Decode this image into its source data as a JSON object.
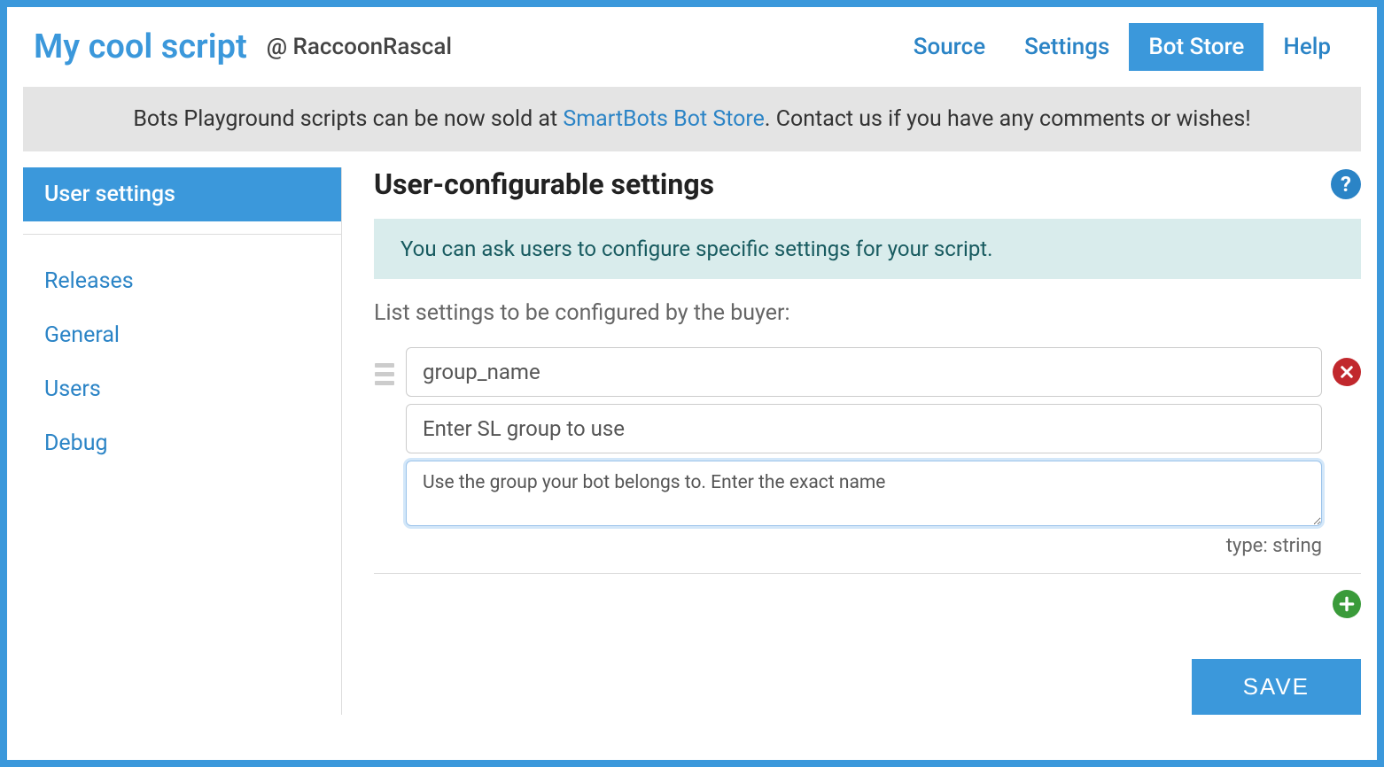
{
  "header": {
    "title": "My cool script",
    "author_prefix": "@ ",
    "author": "RaccoonRascal",
    "tabs": [
      {
        "label": "Source",
        "active": false
      },
      {
        "label": "Settings",
        "active": false
      },
      {
        "label": "Bot Store",
        "active": true
      },
      {
        "label": "Help",
        "active": false
      }
    ]
  },
  "banner": {
    "text_before": "Bots Playground scripts can be now sold at ",
    "link_text": "SmartBots Bot Store",
    "text_after": ". Contact us if you have any comments or wishes!"
  },
  "sidebar": {
    "items": [
      {
        "label": "User settings",
        "active": true
      },
      {
        "label": "Releases",
        "active": false
      },
      {
        "label": "General",
        "active": false
      },
      {
        "label": "Users",
        "active": false
      },
      {
        "label": "Debug",
        "active": false
      }
    ]
  },
  "main": {
    "title": "User-configurable settings",
    "help_symbol": "?",
    "info_text": "You can ask users to configure specific settings for your script.",
    "list_label": "List settings to be configured by the buyer:",
    "setting": {
      "name": "group_name",
      "prompt": "Enter SL group to use",
      "description": "Use the group your bot belongs to. Enter the exact name",
      "type_label": "type: string"
    },
    "save_label": "SAVE"
  }
}
